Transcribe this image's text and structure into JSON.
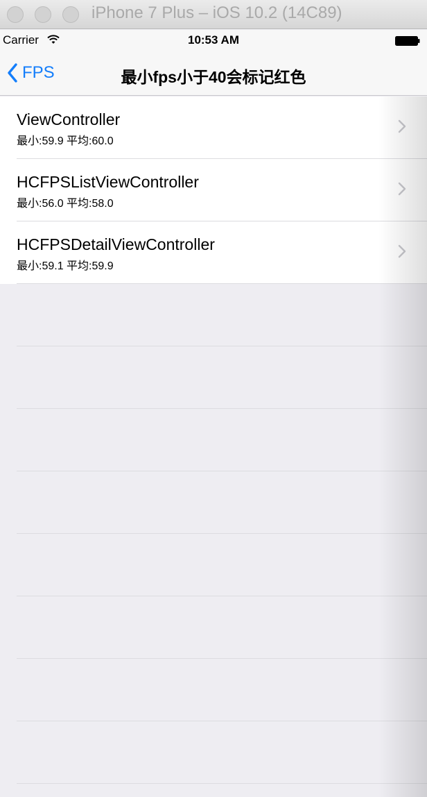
{
  "window": {
    "title": "iPhone 7 Plus – iOS 10.2 (14C89)"
  },
  "status_bar": {
    "carrier": "Carrier",
    "time": "10:53 AM"
  },
  "nav": {
    "back_label": "FPS",
    "title": "最小fps小于40会标记红色"
  },
  "rows": [
    {
      "title": "ViewController",
      "subtitle": "最小:59.9 平均:60.0"
    },
    {
      "title": "HCFPSListViewController",
      "subtitle": "最小:56.0 平均:58.0"
    },
    {
      "title": "HCFPSDetailViewController",
      "subtitle": "最小:59.1 平均:59.9"
    }
  ],
  "colors": {
    "accent": "#147efb",
    "background": "#eeedf2",
    "separator": "#dcdce0"
  }
}
